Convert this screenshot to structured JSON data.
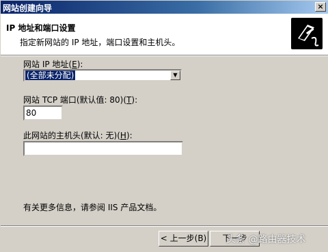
{
  "window": {
    "title": "网站创建向导",
    "close_label": "×"
  },
  "header": {
    "title": "IP 地址和端口设置",
    "subtitle": "指定新网站的 IP 地址，端口设置和主机头。"
  },
  "form": {
    "ip_label": "网站 IP 地址(",
    "ip_key": "E",
    "ip_label_end": "):",
    "ip_value": "(全部未分配)",
    "port_label": "网站 TCP 端口(默认值: 80)(",
    "port_key": "T",
    "port_label_end": "):",
    "port_value": "80",
    "host_label": "此网站的主机头(默认: 无)(",
    "host_key": "H",
    "host_label_end": "):",
    "host_value": ""
  },
  "info_text": "有关更多信息，请参阅 IIS 产品文档。",
  "buttons": {
    "back_label": "< 上一步(B)",
    "next_label": "下一步"
  },
  "watermark": "头条 @路由器技术"
}
